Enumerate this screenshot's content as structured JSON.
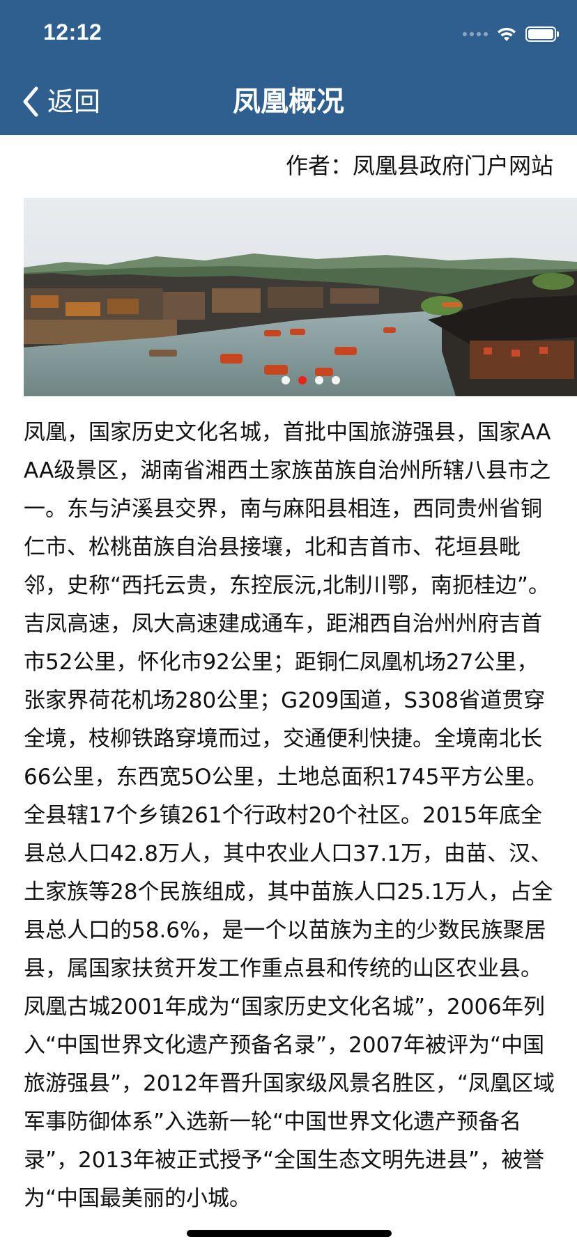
{
  "status_bar": {
    "time": "12:12"
  },
  "nav": {
    "back_label": "返回",
    "title": "凤凰概况"
  },
  "author": "作者：凤凰县政府门户网站",
  "banner": {
    "image_description_icon": "photo-of-river-town",
    "page_indicator": {
      "count": 4,
      "active_index": 1
    }
  },
  "article": {
    "text": "凤凰，国家历史文化名城，首批中国旅游强县，国家AAAA级景区，湖南省湘西土家族苗族自治州所辖八县市之一。东与泸溪县交界，南与麻阳县相连，西同贵州省铜仁市、松桃苗族自治县接壤，北和吉首市、花垣县毗邻，史称“西托云贵，东控辰沅,北制川鄂，南扼桂边”。吉凤高速，凤大高速建成通车，距湘西自治州州府吉首市52公里，怀化市92公里；距铜仁凤凰机场27公里，张家界荷花机场280公里；G209国道，S308省道贯穿全境，枝柳铁路穿境而过，交通便利快捷。全境南北长66公里，东西宽5O公里，土地总面积1745平方公里。全县辖17个乡镇261个行政村20个社区。2015年底全县总人口42.8万人，其中农业人口37.1万，由苗、汉、土家族等28个民族组成，其中苗族人口25.1万人，占全县总人口的58.6%，是一个以苗族为主的少数民族聚居县，属国家扶贫开发工作重点县和传统的山区农业县。凤凰古城2001年成为“国家历史文化名城”，2006年列入“中国世界文化遗产预备名录”，2007年被评为“中国旅游强县”，2012年晋升国家级风景名胜区，“凤凰区域军事防御体系”入选新一轮“中国世界文化遗产预备名录”，2013年被正式授予“全国生态文明先进县”，被誉为“中国最美丽的小城。"
  },
  "colors": {
    "nav_bg": "#2f5f8f",
    "active_dot": "#e8231c"
  }
}
